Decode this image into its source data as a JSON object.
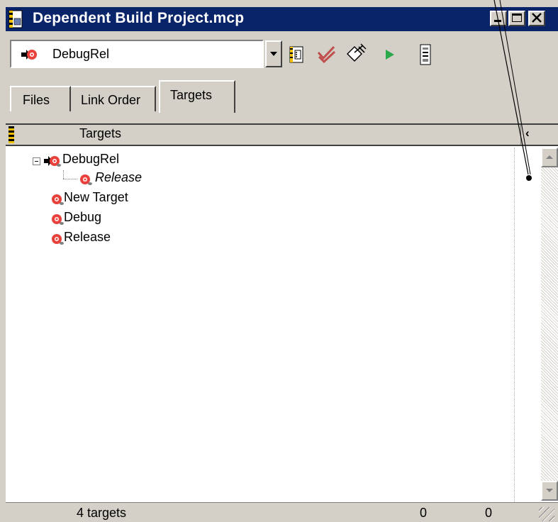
{
  "window": {
    "title": "Dependent Build Project.mcp",
    "controls": [
      "minimize-icon",
      "maximize-icon",
      "close-icon"
    ]
  },
  "toolbar": {
    "target_select": {
      "value": "DebugRel",
      "icon": "target-icon"
    },
    "tools": [
      "target-settings-icon",
      "synchronize-icon",
      "make-icon",
      "run-icon",
      "debug-icon"
    ]
  },
  "tabs": [
    {
      "label": "Files",
      "active": false
    },
    {
      "label": "Link Order",
      "active": false
    },
    {
      "label": "Targets",
      "active": true
    }
  ],
  "targets_list": {
    "column_header": "Targets",
    "items": [
      {
        "label": "DebugRel",
        "level": 0,
        "expanded": true,
        "italic": false,
        "icon": "composite-target-icon"
      },
      {
        "label": "Release",
        "level": 1,
        "italic": true,
        "icon": "target-icon"
      },
      {
        "label": "New Target",
        "level": 0,
        "italic": false,
        "icon": "target-icon"
      },
      {
        "label": "Debug",
        "level": 0,
        "italic": false,
        "icon": "target-icon"
      },
      {
        "label": "Release",
        "level": 0,
        "italic": false,
        "icon": "target-icon"
      }
    ]
  },
  "status": {
    "count": "4 targets",
    "col1": "0",
    "col2": "0"
  },
  "colors": {
    "titlebar": "#0a246a",
    "chrome": "#d4d0c8",
    "target_red": "#e8403a"
  }
}
